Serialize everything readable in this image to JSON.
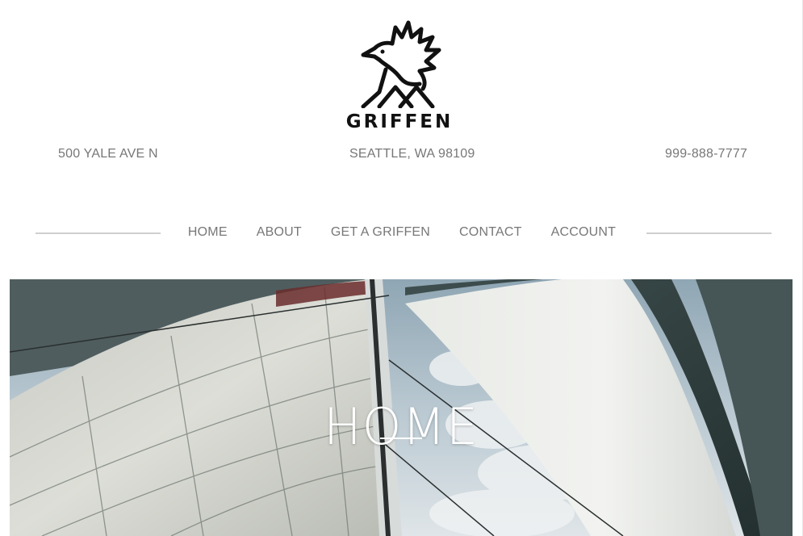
{
  "brand": {
    "name": "GRIFFEN",
    "logo_icon": "griffin-icon",
    "logo_color": "#111111"
  },
  "info": {
    "address": "500 YALE AVE N",
    "city": "SEATTLE, WA 98109",
    "phone": "999-888-7777"
  },
  "nav": {
    "items": [
      {
        "label": "HOME"
      },
      {
        "label": "ABOUT"
      },
      {
        "label": "GET A GRIFFEN"
      },
      {
        "label": "CONTACT"
      },
      {
        "label": "ACCOUNT"
      }
    ]
  },
  "hero": {
    "title": "HOME",
    "image": "sailboat-sails-photo"
  },
  "colors": {
    "text_muted": "#777777",
    "rule": "#cfcfcf",
    "hero_text": "#ffffff"
  }
}
